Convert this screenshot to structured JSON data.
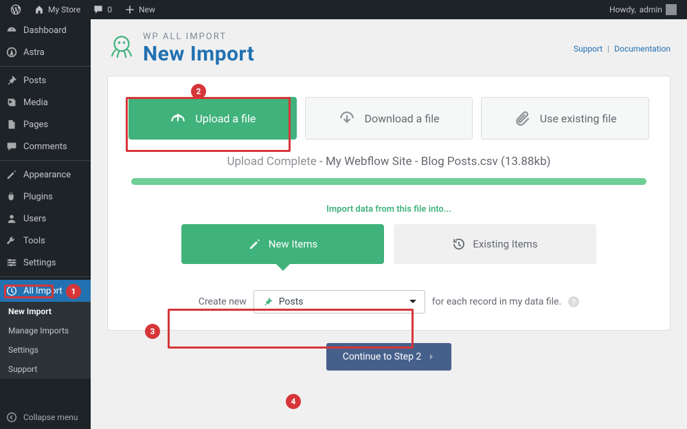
{
  "adminbar": {
    "site_name": "My Store",
    "comments_count": "0",
    "new_label": "New",
    "howdy_prefix": "Howdy,",
    "user_name": "admin"
  },
  "sidebar": {
    "items": [
      {
        "icon": "dashboard",
        "label": "Dashboard"
      },
      {
        "icon": "astra",
        "label": "Astra"
      },
      {
        "icon": "pin",
        "label": "Posts"
      },
      {
        "icon": "media",
        "label": "Media"
      },
      {
        "icon": "pages",
        "label": "Pages"
      },
      {
        "icon": "comments",
        "label": "Comments"
      },
      {
        "icon": "appearance",
        "label": "Appearance"
      },
      {
        "icon": "plugins",
        "label": "Plugins"
      },
      {
        "icon": "users",
        "label": "Users"
      },
      {
        "icon": "tools",
        "label": "Tools"
      },
      {
        "icon": "settings",
        "label": "Settings"
      },
      {
        "icon": "allimport",
        "label": "All Import"
      }
    ],
    "submenu": [
      {
        "label": "New Import",
        "current": true
      },
      {
        "label": "Manage Imports"
      },
      {
        "label": "Settings"
      },
      {
        "label": "Support"
      }
    ],
    "collapse_label": "Collapse menu"
  },
  "header": {
    "brand_top": "WP ALL IMPORT",
    "brand_main": "New Import",
    "link_support": "Support",
    "link_docs": "Documentation"
  },
  "source_tabs": {
    "upload": "Upload a file",
    "download": "Download a file",
    "existing": "Use existing file"
  },
  "upload": {
    "status_label": "Upload Complete",
    "filename": "My Webflow Site - Blog Posts.csv",
    "filesize": "(13.88kb)"
  },
  "into": {
    "heading": "Import data from this file into...",
    "new_items": "New Items",
    "existing_items": "Existing Items",
    "create_prefix": "Create new",
    "post_type": "Posts",
    "create_suffix": "for each record in my data file."
  },
  "continue_label": "Continue to Step 2",
  "annotations": {
    "b1": "1",
    "b2": "2",
    "b3": "3",
    "b4": "4"
  }
}
